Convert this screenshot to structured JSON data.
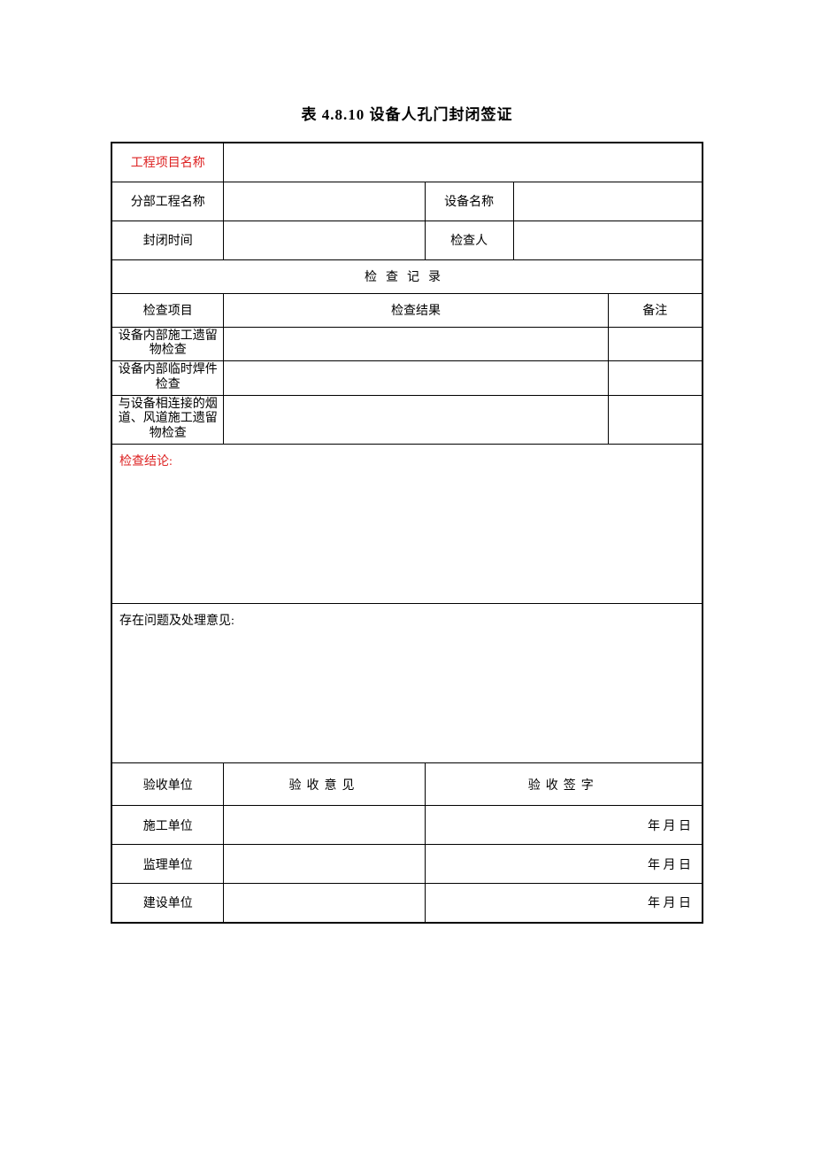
{
  "title": "表 4.8.10 设备人孔门封闭签证",
  "labels": {
    "project_name": "工程项目名称",
    "sub_project_name": "分部工程名称",
    "equipment_name": "设备名称",
    "closing_time": "封闭时间",
    "inspector": "检查人",
    "inspection_record": "检查记录",
    "inspection_item": "检查项目",
    "inspection_result": "检查结果",
    "remark": "备注",
    "item1": "设备内部施工遗留物检查",
    "item2": "设备内部临时焊件检查",
    "item3": "与设备相连接的烟道、风道施工遗留物检查",
    "conclusion": "检查结论:",
    "issues": "存在问题及处理意见:",
    "acceptance_unit": "验收单位",
    "acceptance_opinion": "验收意见",
    "acceptance_signature": "验收签字",
    "construction_unit": "施工单位",
    "supervision_unit": "监理单位",
    "build_unit": "建设单位",
    "date_str": "年   月   日"
  }
}
